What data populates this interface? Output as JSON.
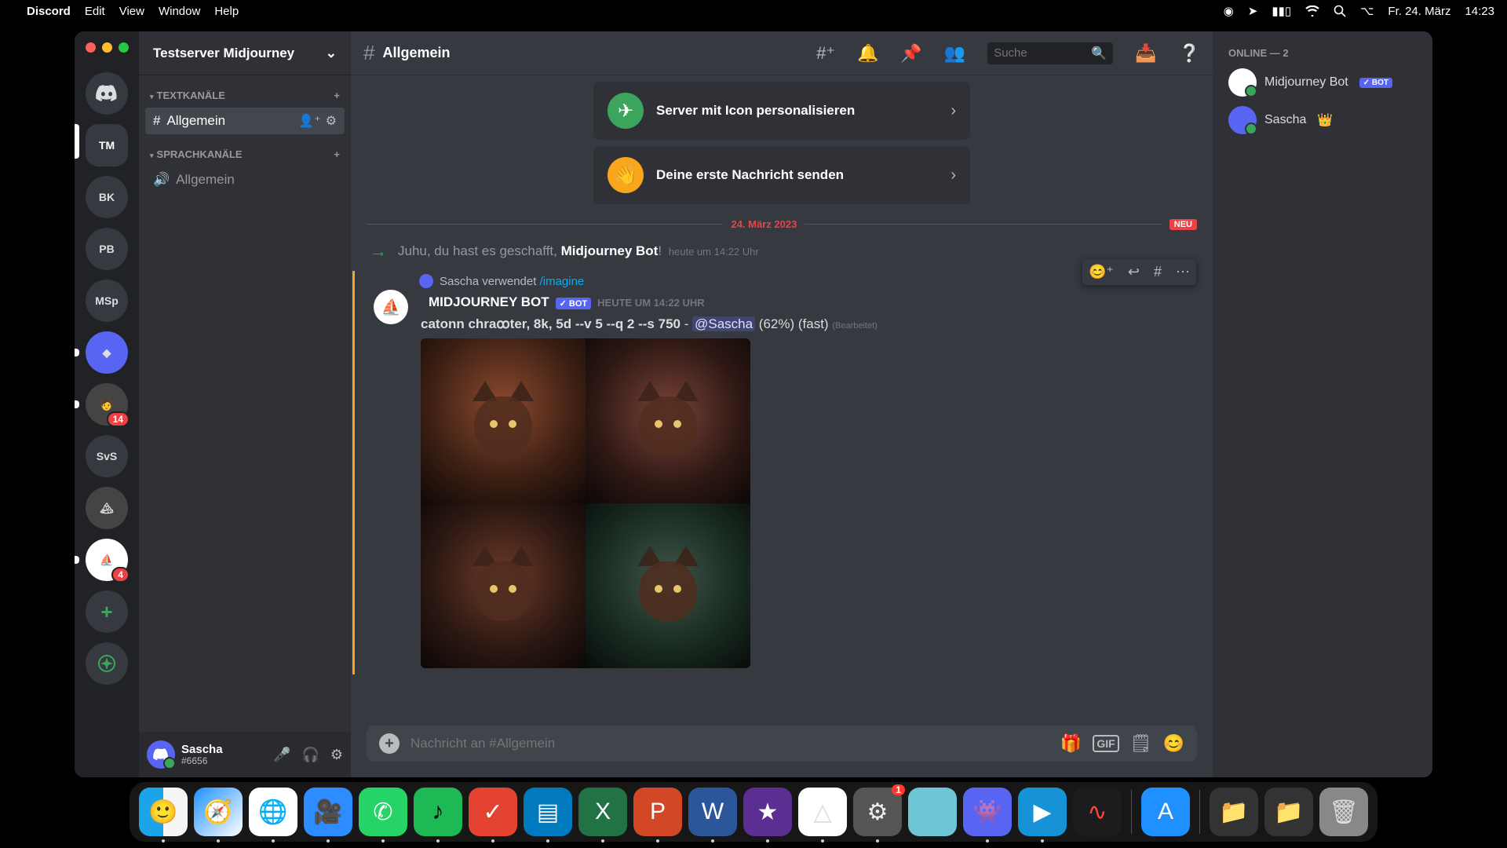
{
  "menubar": {
    "app": "Discord",
    "items": [
      "Edit",
      "View",
      "Window",
      "Help"
    ],
    "date": "Fr. 24. März",
    "time": "14:23"
  },
  "server": {
    "name": "Testserver Midjourney",
    "rail": {
      "home_label": "Home",
      "servers": [
        {
          "label": "TM",
          "active": true
        },
        {
          "label": "BK"
        },
        {
          "label": "PB"
        },
        {
          "label": "MSp"
        },
        {
          "label": "",
          "style": "blue"
        },
        {
          "label": "",
          "style": "img",
          "badge": "14"
        },
        {
          "label": "SvS"
        },
        {
          "label": "",
          "style": "img"
        },
        {
          "label": "",
          "style": "img",
          "badge": "4"
        }
      ]
    }
  },
  "channels": {
    "text_header": "Textkanäle",
    "text": [
      {
        "name": "Allgemein",
        "selected": true
      }
    ],
    "voice_header": "Sprachkanäle",
    "voice": [
      {
        "name": "Allgemein"
      }
    ]
  },
  "user_panel": {
    "name": "Sascha",
    "tag": "#6656"
  },
  "header": {
    "channel": "Allgemein",
    "search_placeholder": "Suche"
  },
  "chat": {
    "cards": [
      {
        "icon": "paper-plane",
        "text": "Server mit Icon personalisieren"
      },
      {
        "icon": "wave",
        "text": "Deine erste Nachricht senden"
      }
    ],
    "divider_date": "24. März 2023",
    "divider_new": "NEU",
    "system": {
      "prefix": "Juhu, du hast es geschafft, ",
      "target": "Midjourney Bot",
      "suffix": "!",
      "time": "heute um 14:22 Uhr"
    },
    "message": {
      "used_prefix": "Sascha verwendet",
      "command": "/imagine",
      "author": "Midjourney Bot",
      "bot_badge": "✓ BOT",
      "time": "heute um 14:22 Uhr",
      "text_prompt": "catonn chraꝏter, 8k, 5d --v 5 --q 2 --s 750",
      "mention": "@Sascha",
      "progress": "(62%) (fast)",
      "edited": "(Bearbeitet)"
    },
    "message_actions": [
      "add-reaction",
      "reply",
      "thread",
      "more"
    ]
  },
  "composer": {
    "placeholder": "Nachricht an #Allgemein"
  },
  "members": {
    "header": "ONLINE — 2",
    "list": [
      {
        "name": "Midjourney Bot",
        "bot": true,
        "badge": "✓ BOT"
      },
      {
        "name": "Sascha",
        "owner": true
      }
    ]
  },
  "dock": {
    "apps": [
      "Finder",
      "Safari",
      "Chrome",
      "Zoom",
      "WhatsApp",
      "Spotify",
      "Todoist",
      "Trello",
      "Excel",
      "PowerPoint",
      "Word",
      "iMovie",
      "Drive",
      "Settings",
      "Circle",
      "Discord",
      "QuickTime",
      "VoiceMemos",
      "AppStore"
    ]
  }
}
